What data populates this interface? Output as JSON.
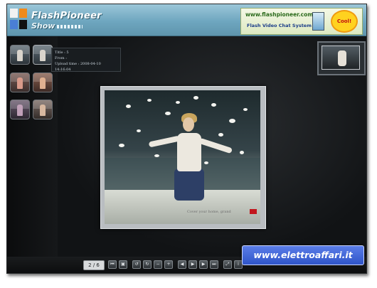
{
  "brand": {
    "title": "FlashPioneer",
    "subtitle": "Show"
  },
  "ad": {
    "url": "www.flashpioneer.com",
    "description": "Flash Video Chat System",
    "badge": "Cool!"
  },
  "tooltip": {
    "title_line": "Title : 5",
    "from_line": "From :",
    "upload_line": "Upload time : 2008-04-10 14:16:04"
  },
  "photo": {
    "caption": "Cover your home, grand"
  },
  "toolbar": {
    "page_indicator": "2 / 6"
  },
  "watermark": "www.elettroaffari.it",
  "colors": {
    "topbar": "#6ea6bf",
    "background": "#0e0f10",
    "watermark": "#2f55c9"
  }
}
